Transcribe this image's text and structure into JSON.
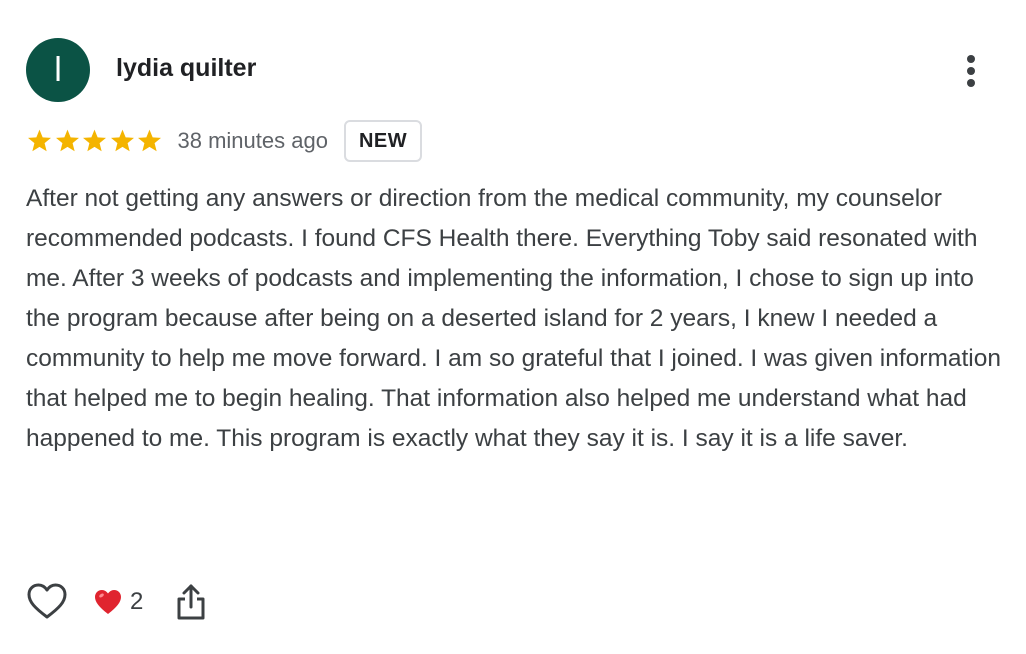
{
  "review": {
    "author_initial": "l",
    "author_name": "lydia quilter",
    "rating": 5,
    "rating_max": 5,
    "time_ago": "38 minutes ago",
    "badge": "NEW",
    "text": "After not getting any answers or direction from the medical community, my counselor recommended podcasts. I found CFS Health there. Everything Toby said resonated with me. After 3 weeks of podcasts and implementing the information, I chose to sign up into the program because after being on a deserted island for 2 years, I knew I needed a community to help me move forward. I am so grateful that I joined. I was given information that helped me to begin healing. That information also helped me understand what had happened to me. This program is exactly what they say it is. I say it is a life saver."
  },
  "actions": {
    "like_icon": "heart-outline-icon",
    "reaction_icon": "red-heart-emoji",
    "reaction_count": "2",
    "share_icon": "share-icon",
    "more_icon": "kebab-menu-icon"
  },
  "colors": {
    "avatar_bg": "#0b5345",
    "star": "#f4b400",
    "text": "#3c4043",
    "heart_emoji": "#e0242f"
  }
}
